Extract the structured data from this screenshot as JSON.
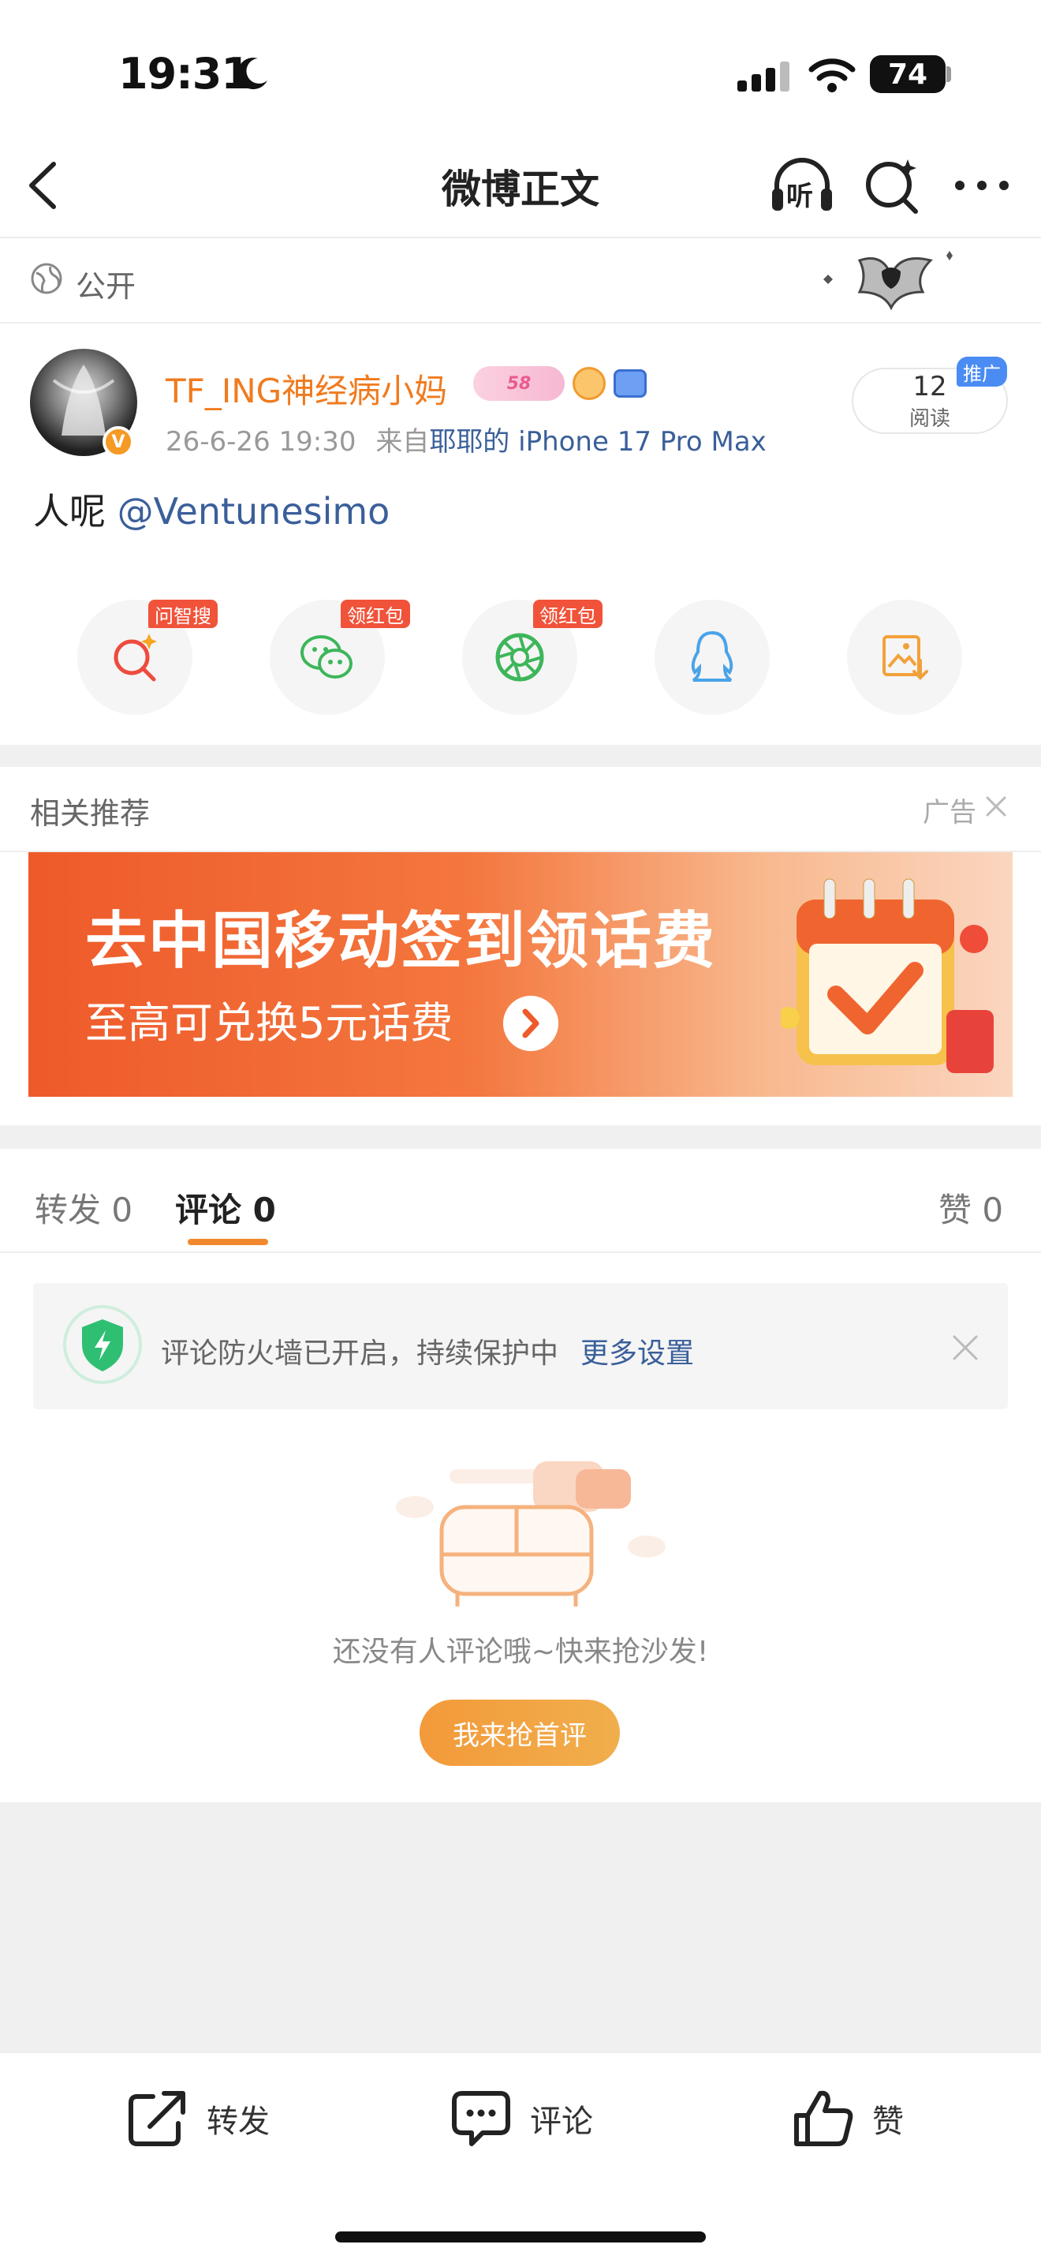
{
  "status_bar": {
    "time": "19:31",
    "battery": "74"
  },
  "nav": {
    "title": "微博正文",
    "listen_label": "听"
  },
  "visibility": {
    "label": "公开"
  },
  "author": {
    "name": "TF_ING神经病小妈",
    "vip_badge": "58",
    "post_time": "26-6-26 19:30",
    "source_prefix": "来自",
    "source": "耶耶的 iPhone 17 Pro Max"
  },
  "reads": {
    "count": "12",
    "label": "阅读",
    "promo_tag": "推广"
  },
  "post": {
    "text": "人呢 ",
    "mention": "@Ventunesimo"
  },
  "share_tags": {
    "search": "问智搜",
    "wechat": "领红包",
    "moments": "领红包"
  },
  "related": {
    "title": "相关推荐",
    "ad_label": "广告"
  },
  "ad_banner": {
    "headline": "去中国移动签到领话费",
    "subline": "至高可兑换5元话费"
  },
  "tabs": {
    "repost": "转发 0",
    "comment": "评论 0",
    "like": "赞 0"
  },
  "firewall": {
    "text": "评论防火墙已开启，持续保护中",
    "link": "更多设置"
  },
  "empty": {
    "text": "还没有人评论哦~快来抢沙发!",
    "button": "我来抢首评"
  },
  "bottom_bar": {
    "repost": "转发",
    "comment": "评论",
    "like": "赞"
  },
  "colors": {
    "accent_orange": "#f07b1f",
    "link_blue": "#3a5f9a",
    "tab_underline": "#f2882d",
    "badge_red": "#f0533a"
  }
}
